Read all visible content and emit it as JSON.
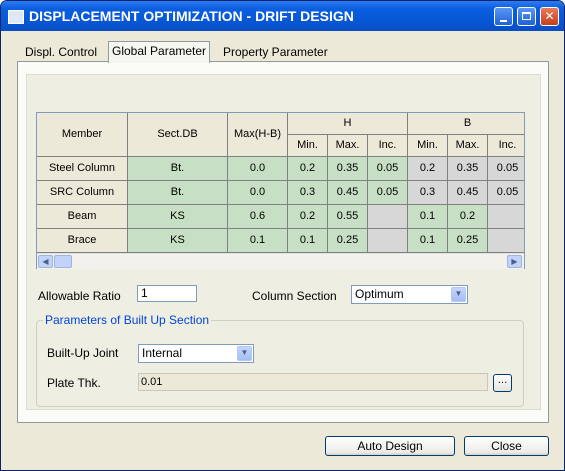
{
  "window": {
    "title": "DISPLACEMENT OPTIMIZATION - DRIFT DESIGN"
  },
  "tabs": [
    {
      "label": "Displ. Control"
    },
    {
      "label": "Global Parameter"
    },
    {
      "label": "Property Parameter"
    }
  ],
  "grid": {
    "headers": {
      "member": "Member",
      "sectdb": "Sect.DB",
      "max_hb": "Max(H-B)",
      "group_h": "H",
      "group_b": "B",
      "min": "Min.",
      "max": "Max.",
      "inc": "Inc."
    },
    "rows": [
      {
        "member": "Steel Column",
        "sectdb": "Bt.",
        "max_hb": "0.0",
        "h_min": "0.2",
        "h_max": "0.35",
        "h_inc": "0.05",
        "b_min": "0.2",
        "b_max": "0.35",
        "b_inc": "0.05"
      },
      {
        "member": "SRC Column",
        "sectdb": "Bt.",
        "max_hb": "0.0",
        "h_min": "0.3",
        "h_max": "0.45",
        "h_inc": "0.05",
        "b_min": "0.3",
        "b_max": "0.45",
        "b_inc": "0.05"
      },
      {
        "member": "Beam",
        "sectdb": "KS",
        "max_hb": "0.6",
        "h_min": "0.2",
        "h_max": "0.55",
        "h_inc": "",
        "b_min": "0.1",
        "b_max": "0.2",
        "b_inc": ""
      },
      {
        "member": "Brace",
        "sectdb": "KS",
        "max_hb": "0.1",
        "h_min": "0.1",
        "h_max": "0.25",
        "h_inc": "",
        "b_min": "0.1",
        "b_max": "0.25",
        "b_inc": ""
      }
    ]
  },
  "form": {
    "allowable_ratio_label": "Allowable Ratio",
    "allowable_ratio_value": "1",
    "column_section_label": "Column Section",
    "column_section_value": "Optimum",
    "group_title": "Parameters of Built Up Section",
    "builtup_joint_label": "Built-Up Joint",
    "builtup_joint_value": "Internal",
    "plate_thk_label": "Plate Thk.",
    "plate_thk_value": "0.01",
    "browse_label": "..."
  },
  "buttons": {
    "auto_design": "Auto Design",
    "close": "Close"
  }
}
